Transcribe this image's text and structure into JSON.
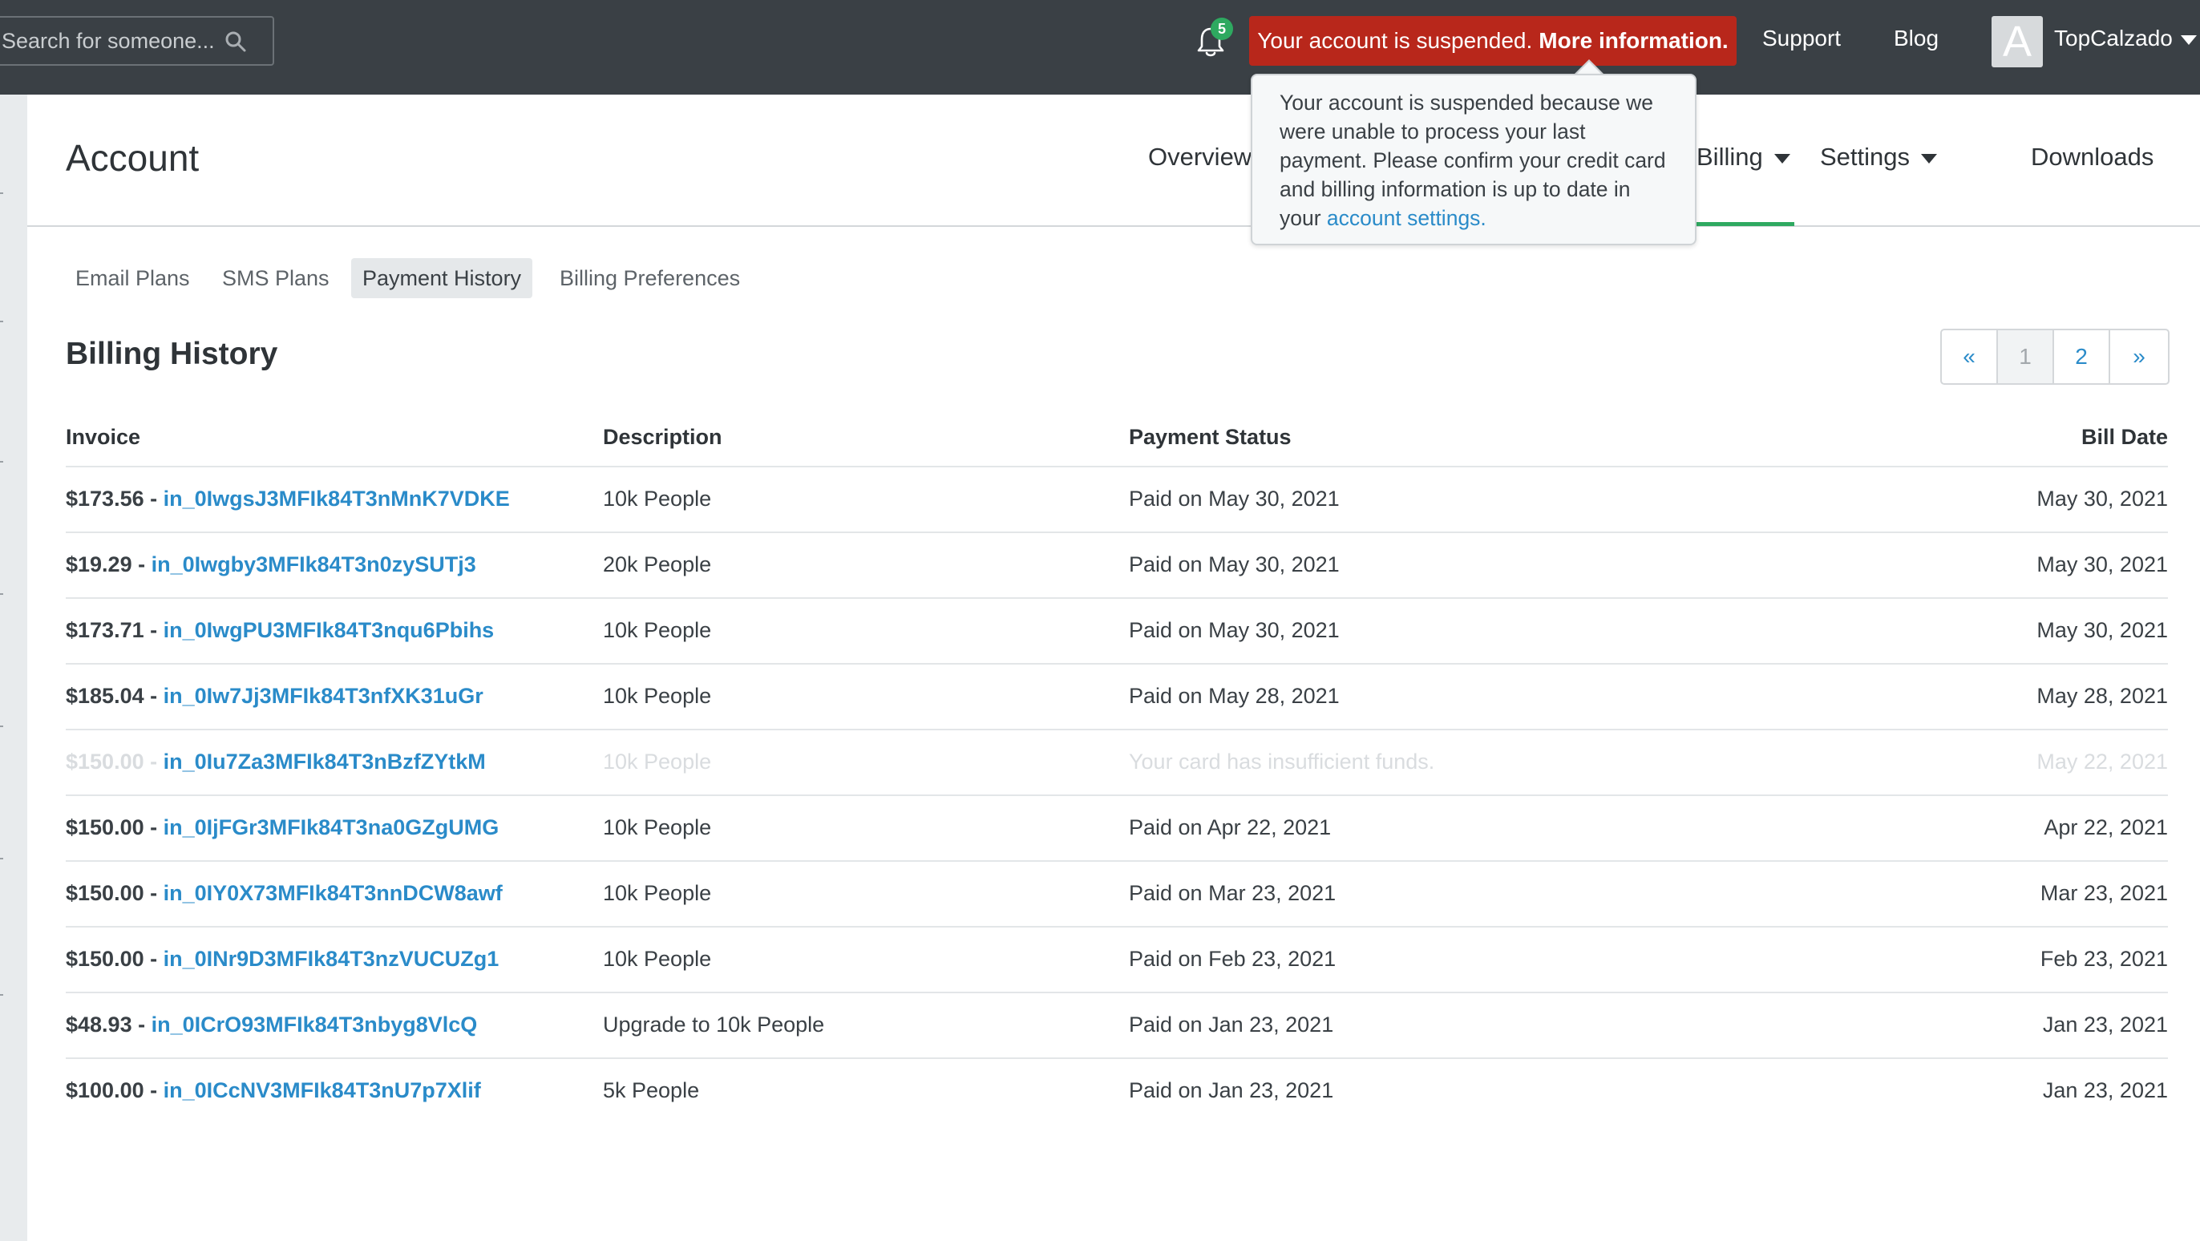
{
  "topbar": {
    "search_placeholder": "Search for someone...",
    "notification_count": "5",
    "alert_text": "Your account is suspended.",
    "alert_link": "More information.",
    "nav": [
      "Support",
      "Blog"
    ],
    "avatar_letter": "A",
    "username": "TopCalzado"
  },
  "tooltip": {
    "text": "Your account is suspended because we were unable to process your last payment. Please confirm your credit card and billing information is up to date in your ",
    "link": "account settings."
  },
  "account": {
    "title": "Account",
    "nav": {
      "overview": "Overview",
      "billing": "Billing",
      "settings": "Settings",
      "downloads": "Downloads"
    }
  },
  "subtabs": [
    "Email Plans",
    "SMS Plans",
    "Payment History",
    "Billing Preferences"
  ],
  "billing": {
    "title": "Billing History",
    "pager": [
      "«",
      "1",
      "2",
      "»"
    ],
    "columns": [
      "Invoice",
      "Description",
      "Payment Status",
      "Bill Date"
    ],
    "rows": [
      {
        "amount": "$173.56",
        "invoice": "in_0IwgsJ3MFIk84T3nMnK7VDKE",
        "desc": "10k People",
        "status": "Paid on May 30, 2021",
        "date": "May 30, 2021"
      },
      {
        "amount": "$19.29",
        "invoice": "in_0Iwgby3MFIk84T3n0zySUTj3",
        "desc": "20k People",
        "status": "Paid on May 30, 2021",
        "date": "May 30, 2021"
      },
      {
        "amount": "$173.71",
        "invoice": "in_0IwgPU3MFIk84T3nqu6Pbihs",
        "desc": "10k People",
        "status": "Paid on May 30, 2021",
        "date": "May 30, 2021"
      },
      {
        "amount": "$185.04",
        "invoice": "in_0Iw7Jj3MFIk84T3nfXK31uGr",
        "desc": "10k People",
        "status": "Paid on May 28, 2021",
        "date": "May 28, 2021"
      },
      {
        "amount": "$150.00",
        "invoice": "in_0Iu7Za3MFIk84T3nBzfZYtkM",
        "desc": "10k People",
        "status": "Your card has insufficient funds.",
        "date": "May 22, 2021"
      },
      {
        "amount": "$150.00",
        "invoice": "in_0IjFGr3MFIk84T3na0GZgUMG",
        "desc": "10k People",
        "status": "Paid on Apr 22, 2021",
        "date": "Apr 22, 2021"
      },
      {
        "amount": "$150.00",
        "invoice": "in_0IY0X73MFIk84T3nnDCW8awf",
        "desc": "10k People",
        "status": "Paid on Mar 23, 2021",
        "date": "Mar 23, 2021"
      },
      {
        "amount": "$150.00",
        "invoice": "in_0INr9D3MFIk84T3nzVUCUZg1",
        "desc": "10k People",
        "status": "Paid on Feb 23, 2021",
        "date": "Feb 23, 2021"
      },
      {
        "amount": "$48.93",
        "invoice": "in_0ICrO93MFIk84T3nbyg8VlcQ",
        "desc": "Upgrade to 10k People",
        "status": "Paid on Jan 23, 2021",
        "date": "Jan 23, 2021"
      },
      {
        "amount": "$100.00",
        "invoice": "in_0ICcNV3MFIk84T3nU7p7Xlif",
        "desc": "5k People",
        "status": "Paid on Jan 23, 2021",
        "date": "Jan 23, 2021"
      }
    ]
  }
}
